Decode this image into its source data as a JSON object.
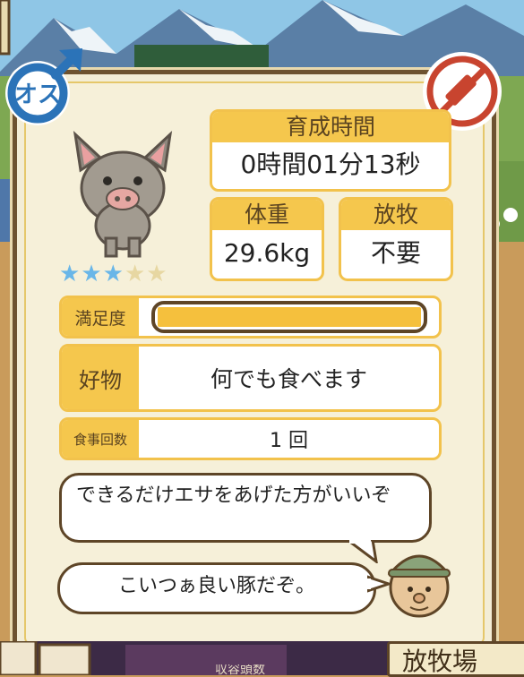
{
  "status": {
    "gender_label": "オス",
    "time_header": "育成時間",
    "time_value": "0時間01分13秒",
    "weight_header": "体重",
    "weight_value": "29.6kg",
    "graze_header": "放牧",
    "graze_value": "不要",
    "stars_filled": 3,
    "stars_total": 5
  },
  "satisfaction": {
    "label": "満足度",
    "level": 1.0
  },
  "favorite": {
    "label": "好物",
    "value": "何でも食べます"
  },
  "meals": {
    "label": "食事回数",
    "value": "1 回"
  },
  "dialog": {
    "tip": "できるだけエサをあげた方がいいぞ",
    "comment": "こいつぁ良い豚だぞ。"
  },
  "footer": {
    "sign_text": "放牧場",
    "small_text": "収容頭数"
  },
  "colors": {
    "accent": "#f5c74d",
    "frame": "#6d5230",
    "male_blue": "#2b73b8",
    "no_injection_red": "#c8442f",
    "star_on": "#69b6e8"
  },
  "icons": {
    "gender": "male-symbol-icon",
    "no_injection": "no-syringe-icon"
  }
}
